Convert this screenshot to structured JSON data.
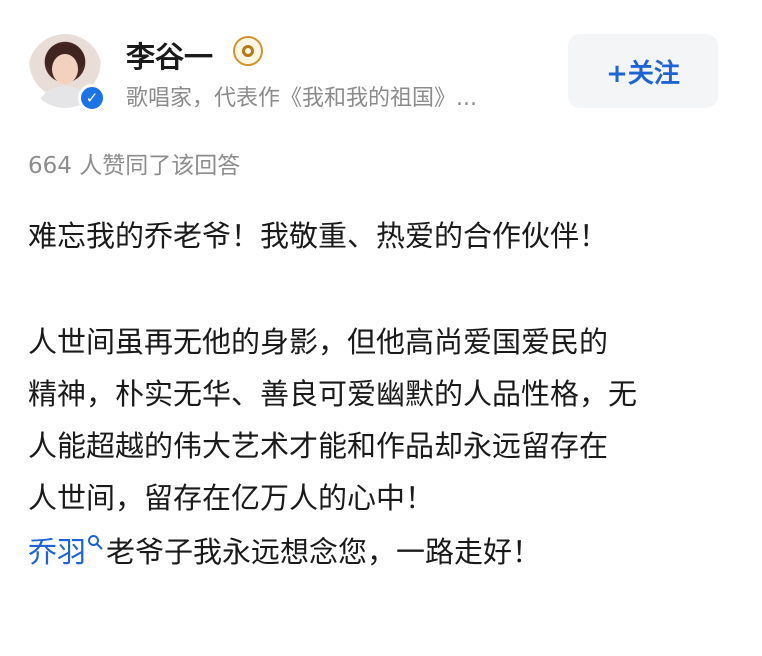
{
  "author": {
    "name": "李谷一",
    "subtitle": "歌唱家，代表作《我和我的祖国》...",
    "follow_label": "+关注",
    "avatar_icon": "user-avatar",
    "verified_icon": "verified-check-icon",
    "badge_icon": "eye-badge-icon",
    "accent_color": "#1b63d6"
  },
  "meta": {
    "agree_text": "664 人赞同了该回答"
  },
  "content": {
    "paragraph1": "难忘我的乔老爷！我敬重、热爱的合作伙伴！",
    "paragraph2_lines": [
      "人世间虽再无他的身影，但他高尚爱国爱民的",
      "精神，朴实无华、善良可爱幽默的人品性格，无",
      "人能超越的伟大艺术才能和作品却永远留存在",
      "人世间，留存在亿万人的心中！"
    ],
    "mention_link": "乔羽",
    "paragraph3_rest": "老爷子我永远想念您，一路走好！"
  }
}
